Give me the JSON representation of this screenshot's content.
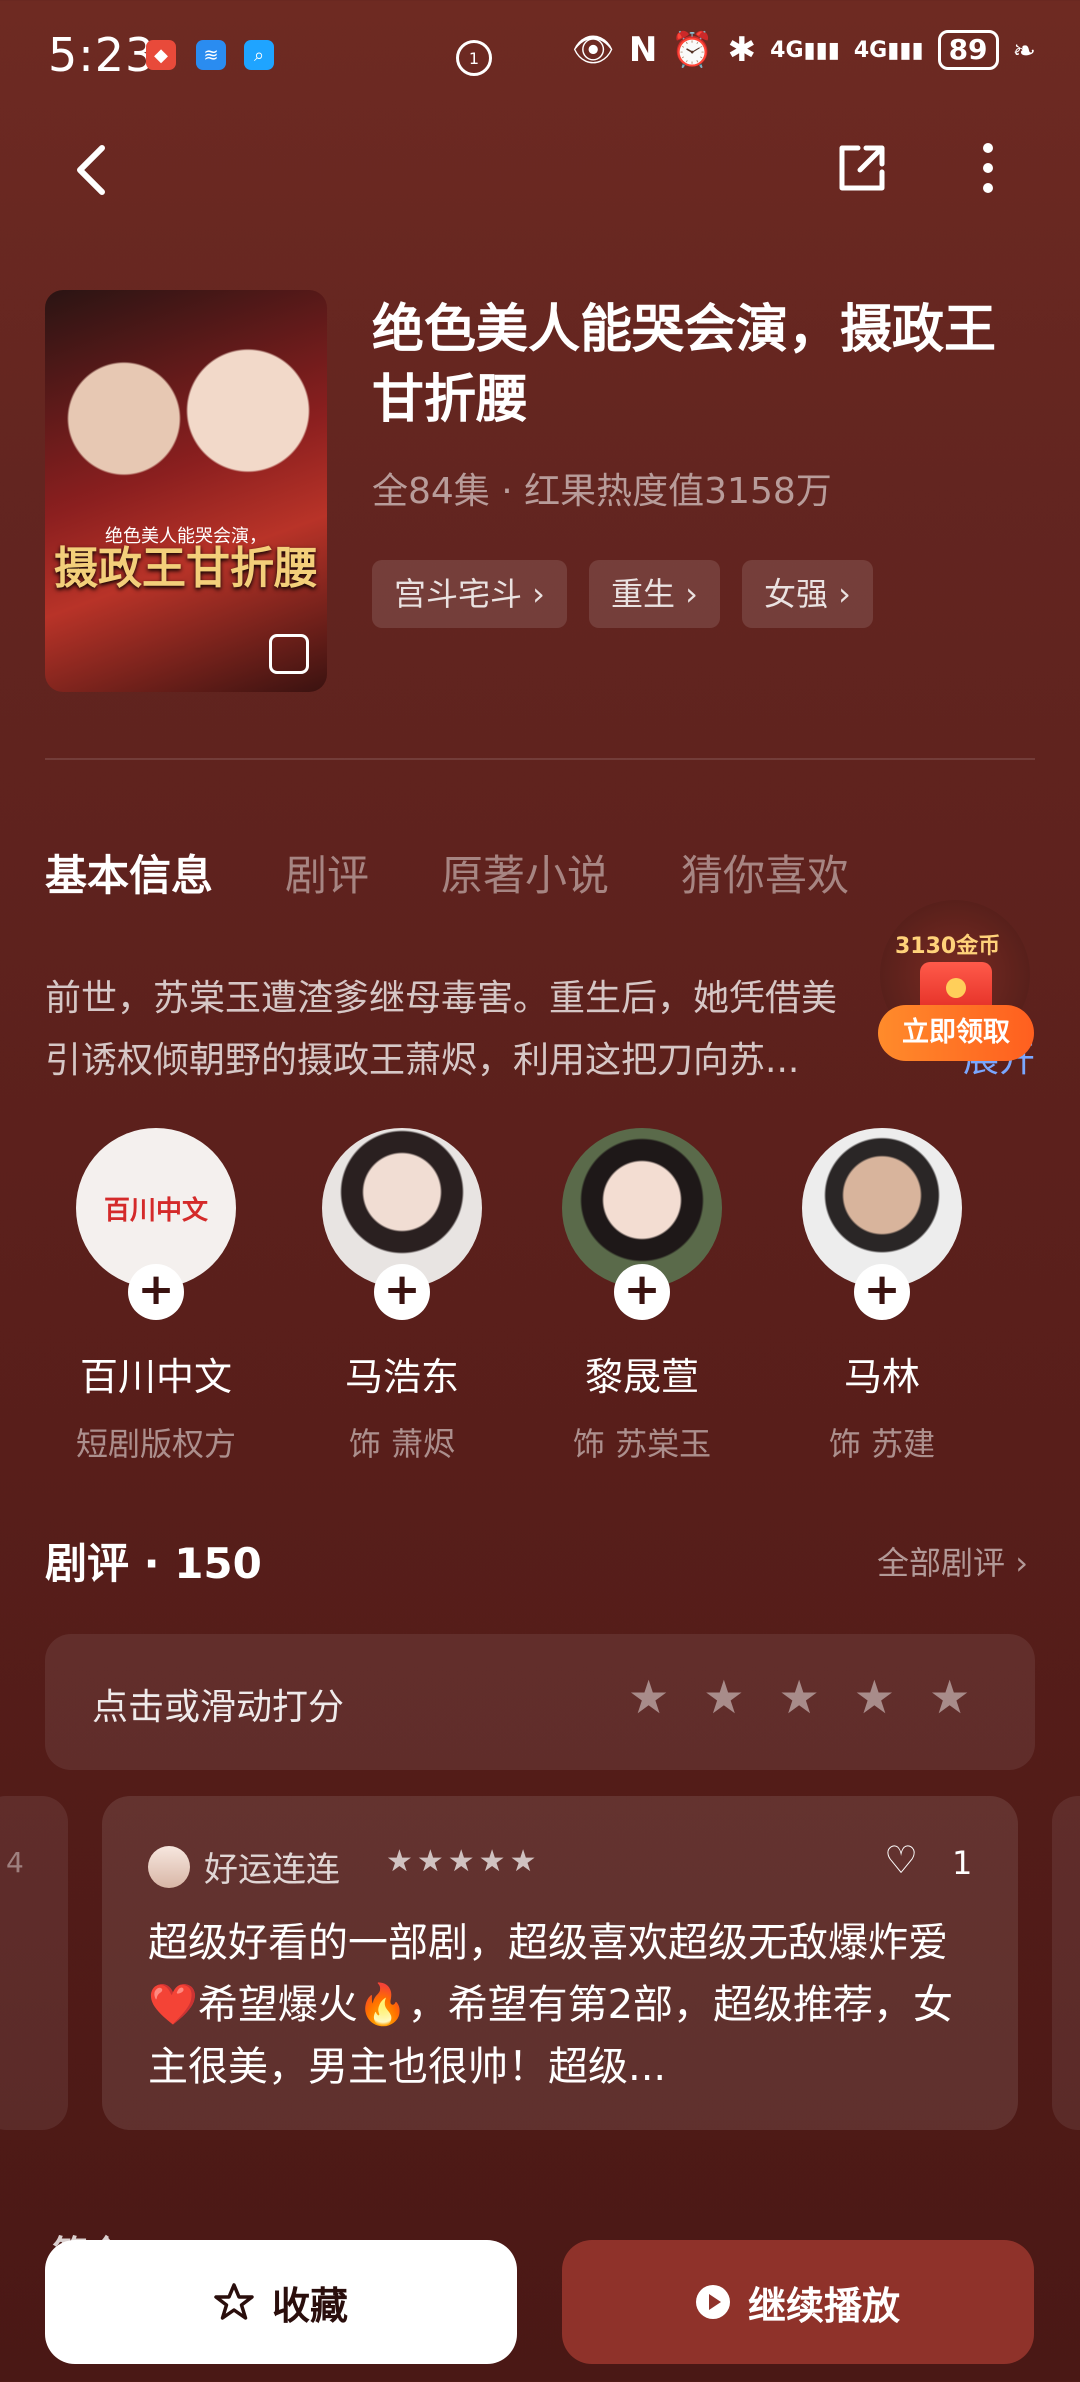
{
  "status_bar": {
    "time": "5:23",
    "battery": "89",
    "network_1": "4G",
    "network_2": "4G"
  },
  "drama": {
    "title": "绝色美人能哭会演，摄政王甘折腰",
    "meta": "全84集 · 红果热度值3158万",
    "poster_title": "摄政王甘折腰",
    "poster_sub": "绝色美人能哭会演，",
    "tags": [
      "宫斗宅斗 ›",
      "重生 ›",
      "女强 ›"
    ]
  },
  "tabs": [
    "基本信息",
    "剧评",
    "原著小说",
    "猜你喜欢"
  ],
  "synopsis": {
    "line1": "前世，苏棠玉遭渣爹继母毒害。重生后，她凭借美",
    "line2": "引诱权倾朝野的摄政王萧烬，利用这把刀向苏...",
    "expand": "展开"
  },
  "coin_promo": {
    "coins": "3130金币",
    "claim": "立即领取"
  },
  "cast": [
    {
      "name": "百川中文",
      "role": "短剧版权方",
      "logo_text": "百川中文"
    },
    {
      "name": "马浩东",
      "role": "饰 萧烬"
    },
    {
      "name": "黎晟萱",
      "role": "饰 苏棠玉"
    },
    {
      "name": "马林",
      "role": "饰 苏建"
    }
  ],
  "reviews": {
    "header": "剧评 · 150",
    "all_link": "全部剧评 ›",
    "rate_prompt": "点击或滑动打分",
    "card": {
      "user": "好运连连",
      "likes": "1",
      "text": "超级好看的一部剧，超级喜欢超级无敌爆炸爱❤️希望爆火🔥，希望有第2部，超级推荐，女主很美，男主也很帅！超级..."
    }
  },
  "bottom": {
    "favorite": "收藏",
    "play": "继续播放",
    "partial": "简介"
  },
  "colors": {
    "background": "#632520",
    "accent_button": "#8f322a",
    "link": "#7aa7ff",
    "promo": "#ff6a24"
  }
}
